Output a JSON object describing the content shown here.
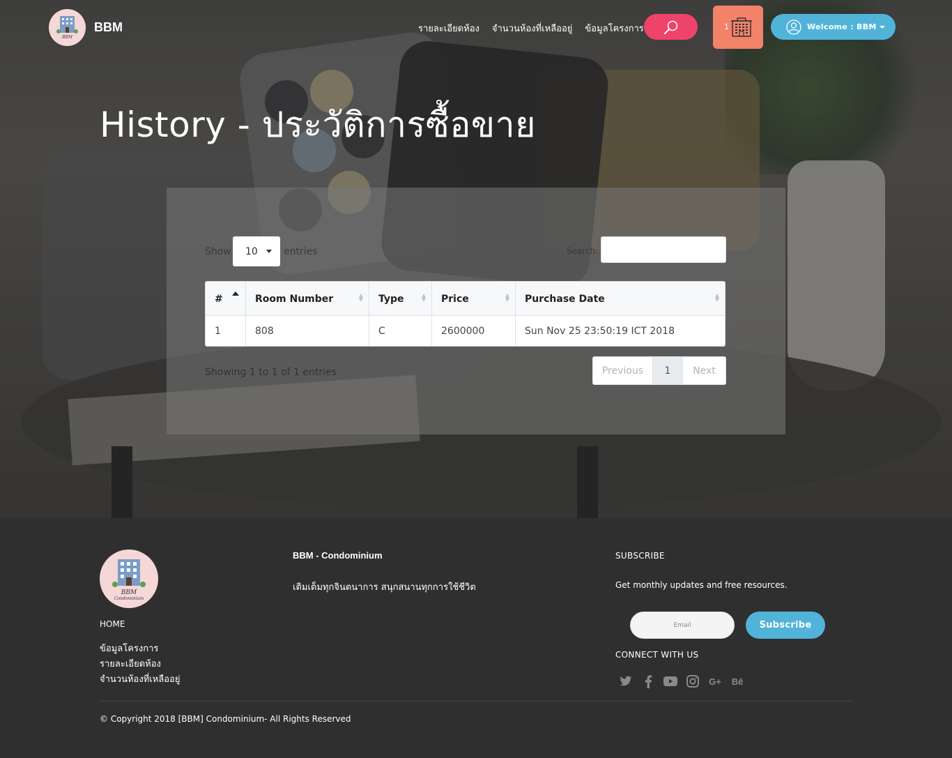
{
  "nav": {
    "brand": "BBM",
    "links": [
      "รายละเอียดห้อง",
      "จำนวนห้องที่เหลืออยู่",
      "ข้อมูลโครงการ"
    ],
    "cart_count": "1",
    "welcome": "Welcome : BBM"
  },
  "page": {
    "title": "History - ประวัติการซื้อขาย"
  },
  "table_controls": {
    "show_label": "Show",
    "page_size": "10",
    "entries_label": "entries",
    "search_label": "Search:"
  },
  "table": {
    "columns": [
      "#",
      "Room Number",
      "Type",
      "Price",
      "Purchase Date"
    ],
    "rows": [
      [
        "1",
        "808",
        "C",
        "2600000",
        "Sun Nov 25 23:50:19 ICT 2018"
      ]
    ]
  },
  "pagination": {
    "info": "Showing 1 to 1 of 1 entries",
    "previous": "Previous",
    "current": "1",
    "next": "Next"
  },
  "footer": {
    "home": "HOME",
    "links": [
      "ข้อมูลโครงการ",
      "รายละเอียดห้อง",
      "จำนวนห้องที่เหลืออยู่"
    ],
    "brand": "BBM - Condominium",
    "tagline": "เติมเต็มทุกจินตนาการ สนุกสนานทุกการใช้ชีวิต",
    "subscribe_title": "SUBSCRIBE",
    "subscribe_text": "Get monthly updates and free resources.",
    "email_placeholder": "Email",
    "subscribe_button": "Subscribe",
    "connect_title": "CONNECT WITH US",
    "socials": [
      "twitter-icon",
      "facebook-icon",
      "youtube-icon",
      "instagram-icon",
      "google-plus-icon",
      "behance-icon"
    ],
    "copyright": "© Copyright 2018 [BBM] Condominium- All Rights Reserved"
  },
  "colors": {
    "search_button": "#f0436a",
    "cart_button": "#f28369",
    "accent_blue": "#52b3d9",
    "footer_bg": "#2f2f2f"
  }
}
